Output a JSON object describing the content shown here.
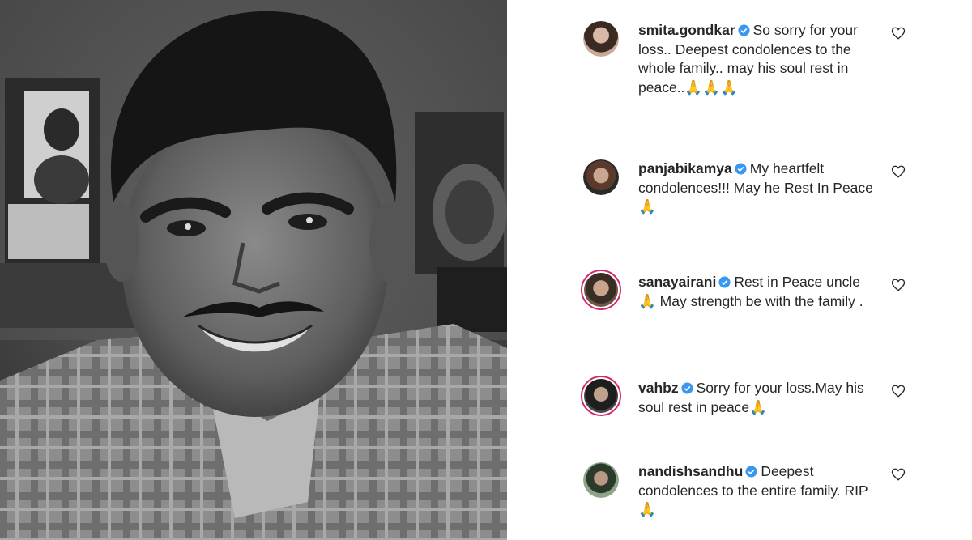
{
  "post": {
    "image_alt": "Vintage black and white portrait photo of a smiling man with a moustache"
  },
  "comments": [
    {
      "username": "smita.gondkar",
      "verified": true,
      "text": "So sorry for your loss.. Deepest condolences to the whole family.. may his soul rest in peace..🙏🙏🙏",
      "avatar_ring": false
    },
    {
      "username": "panjabikamya",
      "verified": true,
      "text": "My heartfelt condolences!!! May he Rest In Peace 🙏",
      "avatar_ring": false
    },
    {
      "username": "sanayairani",
      "verified": true,
      "text": "Rest in Peace uncle 🙏 May strength be with the family .",
      "avatar_ring": true
    },
    {
      "username": "vahbz",
      "verified": true,
      "text": "Sorry for your loss.May his soul rest in peace🙏",
      "avatar_ring": true
    },
    {
      "username": "nandishsandhu",
      "verified": true,
      "text": "Deepest condolences to the entire family. RIP 🙏",
      "avatar_ring": false
    }
  ],
  "colors": {
    "verified_badge": "#3897f0",
    "story_ring": "#d6246e",
    "text": "#262626"
  },
  "icons": {
    "like": "heart-outline-icon",
    "verified": "verified-badge-icon"
  }
}
